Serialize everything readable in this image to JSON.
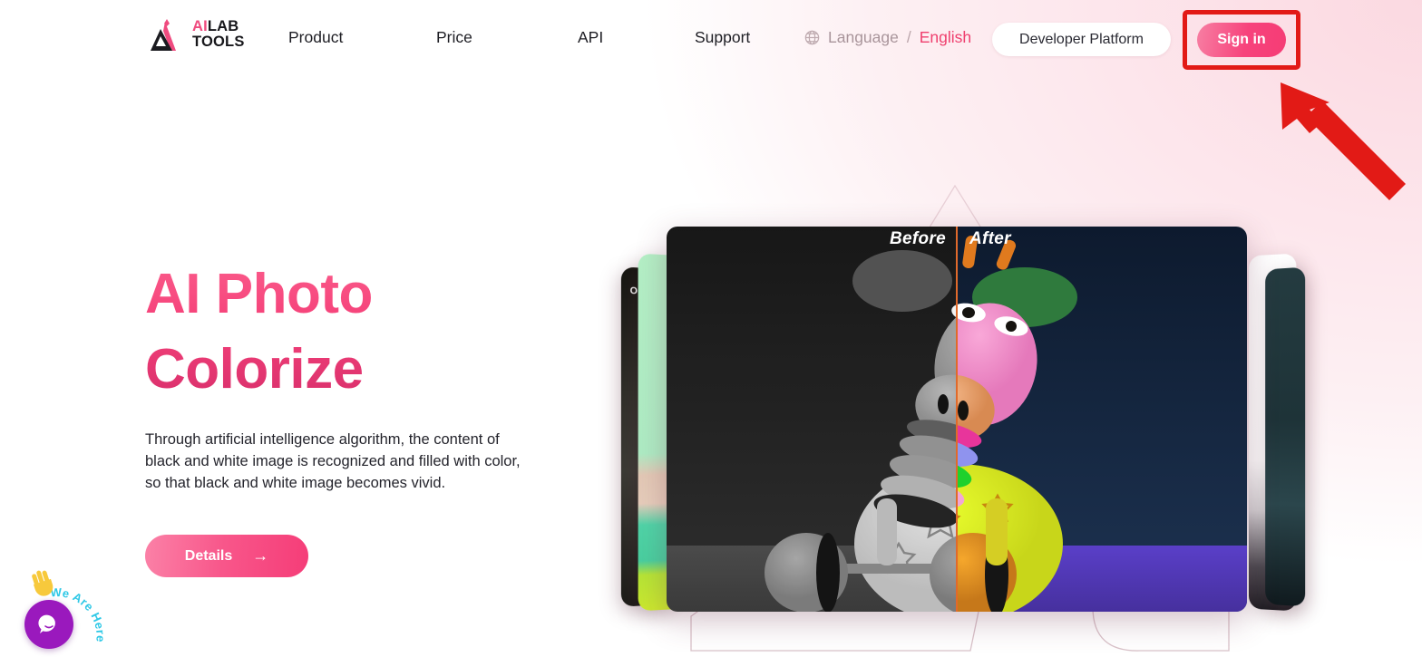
{
  "page": {
    "background_start": "#ffffff",
    "background_end": "#fbd9e1"
  },
  "header": {
    "logo": {
      "icon": "mountain-logo-icon",
      "line1_ai": "AI",
      "line1_lab": "LAB",
      "line2": "TOOLS",
      "accent_color": "#ef4b7f",
      "dark_color": "#17171b"
    },
    "nav": [
      {
        "label": "Product"
      },
      {
        "label": "Price"
      },
      {
        "label": "API"
      },
      {
        "label": "Support"
      }
    ],
    "language": {
      "icon": "globe-icon",
      "label": "Language",
      "separator": "/",
      "value": "English",
      "value_color": "#ef3f6e"
    },
    "developer_platform_label": "Developer Platform",
    "signin_label": "Sign in",
    "signin_gradient_start": "#f77fa3",
    "signin_gradient_end": "#f53c75"
  },
  "annotation": {
    "highlight_color": "#e21a16",
    "highlight_target": "signin-button",
    "arrow_color": "#e21a16",
    "arrow_direction": "up-left"
  },
  "hero": {
    "title": "AI Photo Colorize",
    "title_gradient_start": "#fb5d8c",
    "title_gradient_end": "#d72e6b",
    "description": "Through artificial intelligence algorithm, the content of black and white image is recognized and filled with color, so that black and white image becomes vivid.",
    "cta_label": "Details",
    "cta_arrow": "→"
  },
  "showcase": {
    "before_label": "Before",
    "after_label": "After",
    "slider_handle_icon": "left-right-arrows-icon",
    "slider_handle_color": "#f97d14",
    "slider_position_percent": 50,
    "subject": "toy giraffe on wheels",
    "side_cards": [
      {
        "name": "card-far-left",
        "tone": "dark"
      },
      {
        "name": "card-left",
        "tone": "mint-green"
      },
      {
        "name": "card-right",
        "tone": "white"
      },
      {
        "name": "card-far-right",
        "tone": "dark-teal"
      }
    ]
  },
  "chat_widget": {
    "bubble_text": "We Are Here!",
    "bubble_text_color": "#2ec8e6",
    "button_color": "#9a19bd",
    "icon": "chat-bubble-icon",
    "hand_icon": "waving-hand-icon"
  }
}
